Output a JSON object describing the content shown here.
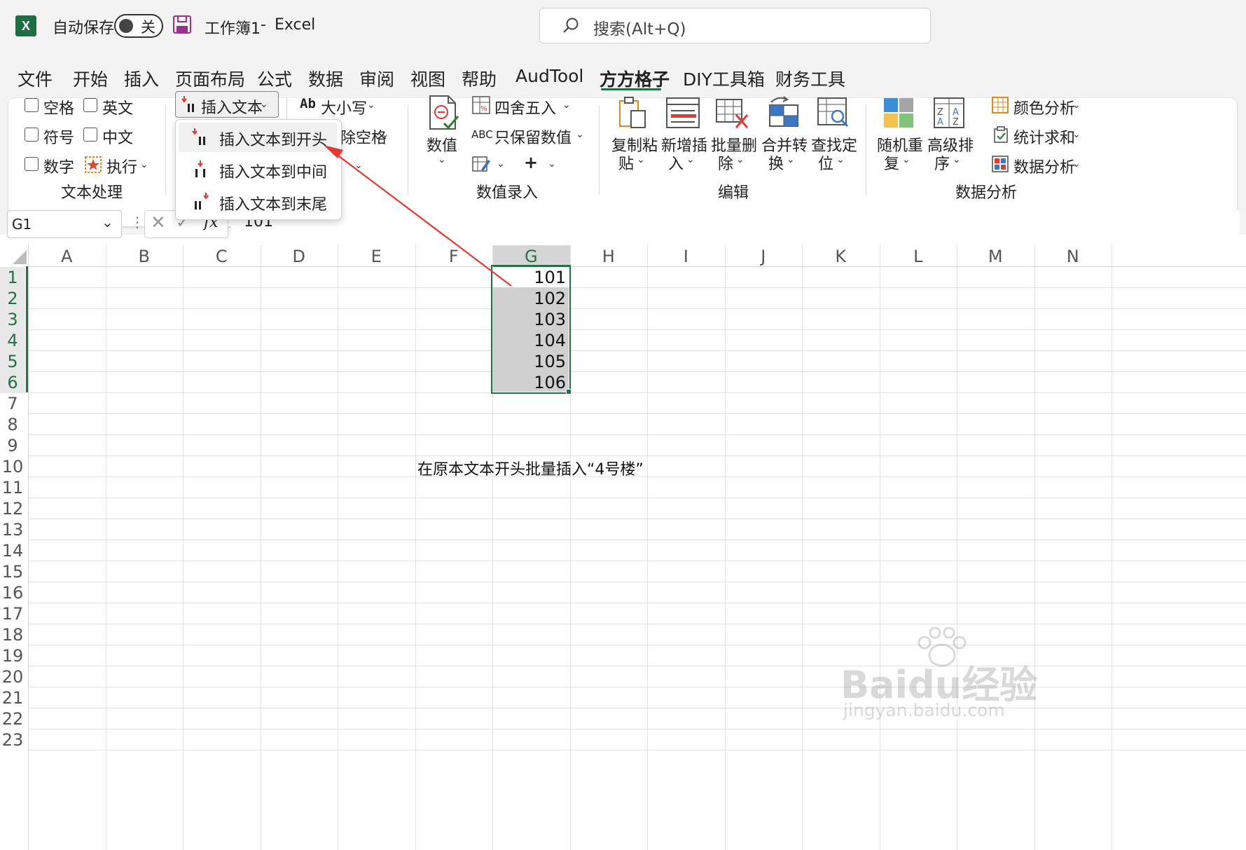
{
  "titlebar": {
    "autosave_label": "自动保存",
    "autosave_state": "关",
    "workbook": "工作簿1",
    "separator": "-",
    "app": "Excel",
    "search_placeholder": "搜索(Alt+Q)"
  },
  "tabs": [
    "文件",
    "开始",
    "插入",
    "页面布局",
    "公式",
    "数据",
    "审阅",
    "视图",
    "帮助",
    "AudTool",
    "方方格子",
    "DIY工具箱",
    "财务工具"
  ],
  "active_tab": "方方格子",
  "ribbon": {
    "text_group": {
      "checkboxes": [
        "空格",
        "英文",
        "符号",
        "中文",
        "数字"
      ],
      "execute": "执行",
      "label": "文本处理",
      "insert_text": "插入文本",
      "case": "大小写",
      "remove_space_partial": "除空格"
    },
    "value_group": {
      "value_btn": "数值",
      "round": "四舍五入",
      "keep_value": "只保留数值",
      "abc": "ABC",
      "label": "数值录入"
    },
    "edit_group": {
      "buttons": [
        {
          "l1": "复制粘",
          "l2": "贴"
        },
        {
          "l1": "新增插",
          "l2": "入"
        },
        {
          "l1": "批量删",
          "l2": "除"
        },
        {
          "l1": "合并转",
          "l2": "换"
        },
        {
          "l1": "查找定",
          "l2": "位"
        }
      ],
      "label": "编辑"
    },
    "analysis_group": {
      "buttons": [
        {
          "l1": "随机重",
          "l2": "复"
        },
        {
          "l1": "高级排",
          "l2": "序"
        }
      ],
      "color_analysis": "颜色分析",
      "stat_sum": "统计求和",
      "data_analysis": "数据分析",
      "label": "数据分析"
    }
  },
  "dropdown": {
    "items": [
      "插入文本到开头",
      "插入文本到中间",
      "插入文本到末尾"
    ]
  },
  "formula_bar": {
    "name_box": "G1",
    "fx": "fx",
    "value": "101"
  },
  "grid": {
    "columns": [
      "A",
      "B",
      "C",
      "D",
      "E",
      "F",
      "G",
      "H",
      "I",
      "J",
      "K",
      "L",
      "M",
      "N"
    ],
    "rows": [
      "1",
      "2",
      "3",
      "4",
      "5",
      "6",
      "7",
      "8",
      "9",
      "10",
      "11",
      "12",
      "13",
      "14",
      "15",
      "16",
      "17",
      "18",
      "19",
      "20",
      "21",
      "22",
      "23"
    ],
    "g_values": [
      "101",
      "102",
      "103",
      "104",
      "105",
      "106"
    ],
    "note": "在原本文本开头批量插入“4号楼”"
  },
  "watermark": {
    "text": "Baidu经验",
    "url": "jingyan.baidu.com"
  },
  "colors": {
    "excel_green": "#217346",
    "selection_fill": "#d0d0d0",
    "arrow_red": "#e53935"
  }
}
